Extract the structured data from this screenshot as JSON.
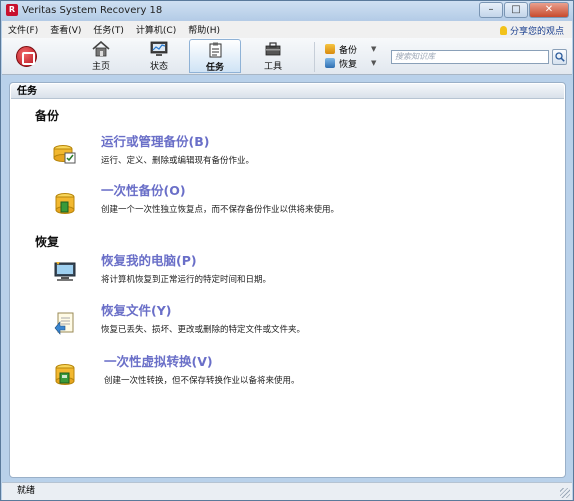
{
  "window": {
    "title": "Veritas System Recovery 18",
    "logo_text": "R"
  },
  "menu": {
    "items": [
      "文件(F)",
      "查看(V)",
      "任务(T)",
      "计算机(C)",
      "帮助(H)"
    ],
    "share": "分享您的观点"
  },
  "toolbar": {
    "buttons": [
      {
        "label": "主页",
        "icon": "home-icon"
      },
      {
        "label": "状态",
        "icon": "status-icon"
      },
      {
        "label": "任务",
        "icon": "tasks-icon",
        "active": true
      },
      {
        "label": "工具",
        "icon": "tools-icon"
      }
    ],
    "mini": [
      {
        "label": "备份",
        "icon": "backup-icon"
      },
      {
        "label": "恢复",
        "icon": "recover-icon"
      }
    ],
    "search_placeholder": "搜索知识库"
  },
  "panel": {
    "header": "任务"
  },
  "sections": [
    {
      "title": "备份",
      "tasks": [
        {
          "title": "运行或管理备份(B)",
          "desc": "运行、定义、删除或编辑现有备份作业。",
          "icon": "manage-backup-icon"
        },
        {
          "title": "一次性备份(O)",
          "desc": "创建一个一次性独立恢复点，而不保存备份作业以供将来使用。",
          "icon": "one-time-backup-icon"
        }
      ]
    },
    {
      "title": "恢复",
      "tasks": [
        {
          "title": "恢复我的电脑(P)",
          "desc": "将计算机恢复到正常运行的特定时间和日期。",
          "icon": "recover-computer-icon"
        },
        {
          "title": "恢复文件(Y)",
          "desc": "恢复已丢失、损坏、更改或删除的特定文件或文件夹。",
          "icon": "recover-files-icon"
        },
        {
          "title": "一次性虚拟转换(V)",
          "desc": "创建一次性转换，但不保存转换作业以备将来使用。",
          "icon": "virtual-conversion-icon"
        }
      ]
    }
  ],
  "status": {
    "text": "就绪"
  },
  "colors": {
    "accent": "#6a6fc8",
    "brand": "#c8102e",
    "frame": "#b9d1ea"
  }
}
